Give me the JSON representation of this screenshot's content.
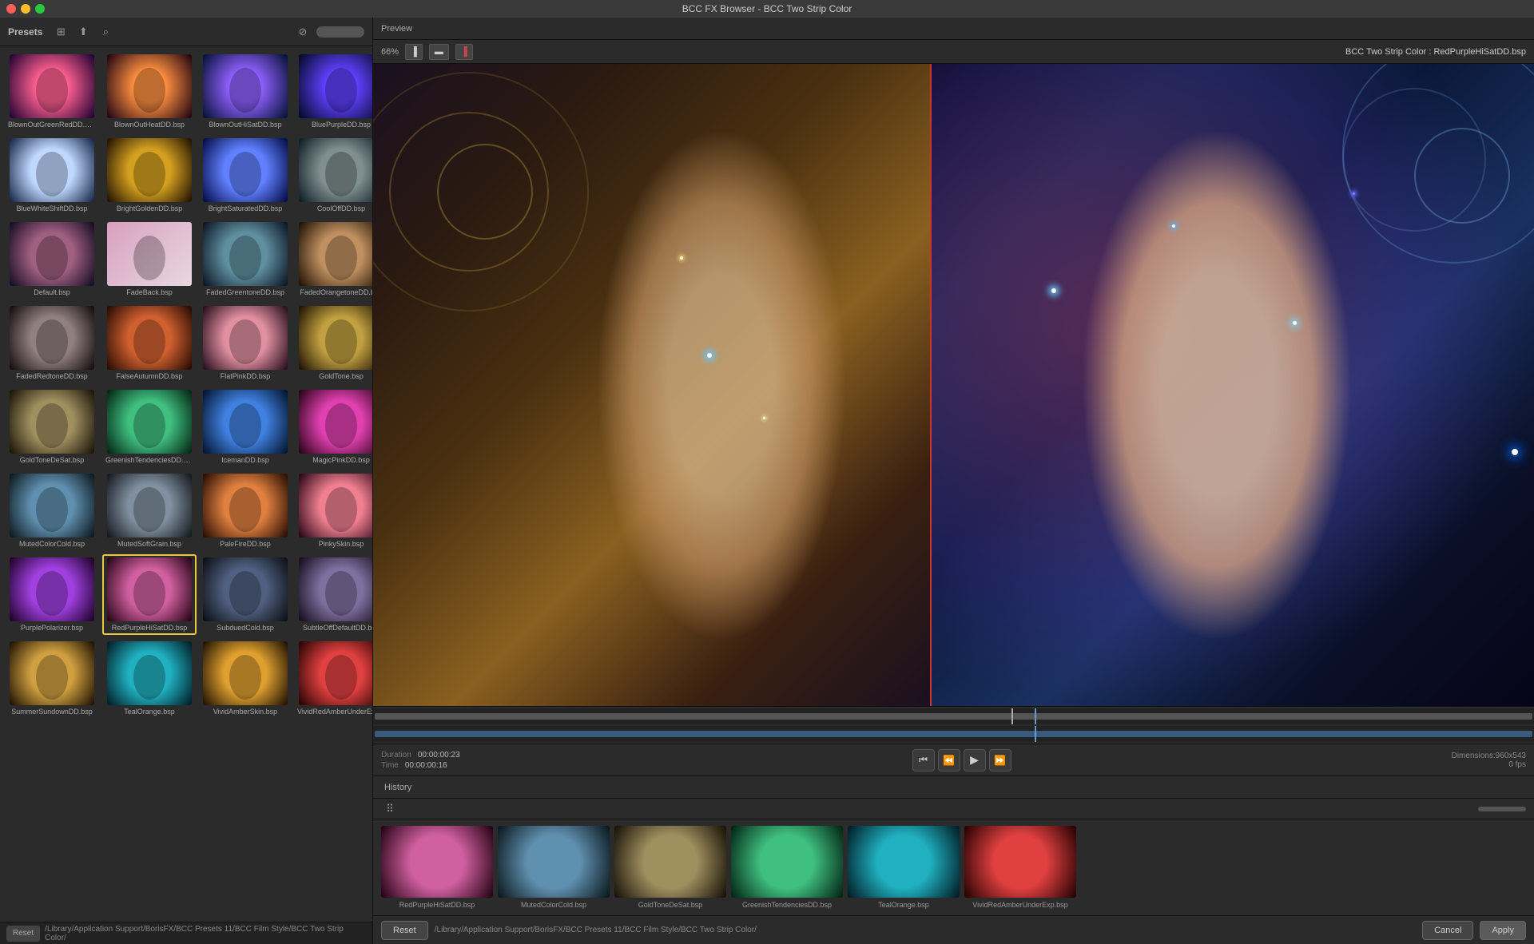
{
  "window": {
    "title": "BCC FX Browser - BCC Two Strip Color"
  },
  "leftPanel": {
    "title": "Presets",
    "searchPlaceholder": "Search"
  },
  "presets": [
    {
      "id": "blown-out-green",
      "label": "BlownOutGreenRedDD.bsp",
      "thumbClass": "thumb-blown-out-green",
      "selected": false
    },
    {
      "id": "blown-out-heat",
      "label": "BlownOutHeatDD.bsp",
      "thumbClass": "thumb-blown-out-heat",
      "selected": false
    },
    {
      "id": "blown-out-sat",
      "label": "BlownOutHiSatDD.bsp",
      "thumbClass": "thumb-blown-out-sat",
      "selected": false
    },
    {
      "id": "blue-purple",
      "label": "BluePurpleDD.bsp",
      "thumbClass": "thumb-blue-purple",
      "selected": false
    },
    {
      "id": "blue-white",
      "label": "BlueWhiteShiftDD.bsp",
      "thumbClass": "thumb-blue-white",
      "selected": false
    },
    {
      "id": "bright-golden",
      "label": "BrightGoldenDD.bsp",
      "thumbClass": "thumb-bright-golden",
      "selected": false
    },
    {
      "id": "bright-sat",
      "label": "BrightSaturatedDD.bsp",
      "thumbClass": "thumb-bright-sat",
      "selected": false
    },
    {
      "id": "cool-off",
      "label": "CoolOffDD.bsp",
      "thumbClass": "thumb-cool-off",
      "selected": false
    },
    {
      "id": "default",
      "label": "Default.bsp",
      "thumbClass": "thumb-default",
      "selected": false
    },
    {
      "id": "fadeback",
      "label": "FadeBack.bsp",
      "thumbClass": "thumb-fadeback",
      "selected": false
    },
    {
      "id": "faded-green",
      "label": "FadedGreentoneDD.bsp",
      "thumbClass": "thumb-faded-green",
      "selected": false
    },
    {
      "id": "faded-orange",
      "label": "FadedOrangetoneDD.bsp",
      "thumbClass": "thumb-faded-orange",
      "selected": false
    },
    {
      "id": "faded-red",
      "label": "FadedRedtoneDD.bsp",
      "thumbClass": "thumb-faded-red",
      "selected": false
    },
    {
      "id": "false-autumn",
      "label": "FalseAutumnDD.bsp",
      "thumbClass": "thumb-false-autumn",
      "selected": false
    },
    {
      "id": "flat-pink",
      "label": "FlatPinkDD.bsp",
      "thumbClass": "thumb-flat-pink",
      "selected": false
    },
    {
      "id": "goldtone",
      "label": "GoldTone.bsp",
      "thumbClass": "thumb-goldtone",
      "selected": false
    },
    {
      "id": "goldtone-desat",
      "label": "GoldToneDeSat.bsp",
      "thumbClass": "thumb-goldtone-desat",
      "selected": false
    },
    {
      "id": "greenish",
      "label": "GreenishTendenciesDD.bsp",
      "thumbClass": "thumb-greenish",
      "selected": false
    },
    {
      "id": "iceman",
      "label": "IcemanDD.bsp",
      "thumbClass": "thumb-iceman",
      "selected": false
    },
    {
      "id": "magic-pink",
      "label": "MagicPinkDD.bsp",
      "thumbClass": "thumb-magic-pink",
      "selected": false
    },
    {
      "id": "muted-cold",
      "label": "MutedColorCold.bsp",
      "thumbClass": "thumb-muted-cold",
      "selected": false
    },
    {
      "id": "muted-soft",
      "label": "MutedSoftGrain.bsp",
      "thumbClass": "thumb-muted-soft",
      "selected": false
    },
    {
      "id": "pale-fire",
      "label": "PaleFireDD.bsp",
      "thumbClass": "thumb-pale-fire",
      "selected": false
    },
    {
      "id": "pinky",
      "label": "PinkySkin.bsp",
      "thumbClass": "thumb-pinky",
      "selected": false
    },
    {
      "id": "purple-pol",
      "label": "PurplePolarizer.bsp",
      "thumbClass": "thumb-purple-pol",
      "selected": false
    },
    {
      "id": "red-purple",
      "label": "RedPurpleHiSatDD.bsp",
      "thumbClass": "thumb-red-purple",
      "selected": true
    },
    {
      "id": "subdued-cold",
      "label": "SubduedCold.bsp",
      "thumbClass": "thumb-subdued-cold",
      "selected": false
    },
    {
      "id": "subtle-off",
      "label": "SubtleOffDefaultDD.bsp",
      "thumbClass": "thumb-subtle-off",
      "selected": false
    },
    {
      "id": "summer-sun",
      "label": "SummerSundownDD.bsp",
      "thumbClass": "thumb-summer-sun",
      "selected": false
    },
    {
      "id": "teal-orange",
      "label": "TealOrange.bsp",
      "thumbClass": "thumb-teal-orange",
      "selected": false
    },
    {
      "id": "vivid-amber",
      "label": "VividAmberSkin.bsp",
      "thumbClass": "thumb-vivid-amber",
      "selected": false
    },
    {
      "id": "vivid-red",
      "label": "VividRedAmberUnderExp.bsp",
      "thumbClass": "thumb-vivid-red",
      "selected": false
    }
  ],
  "preview": {
    "title": "Preview",
    "zoom": "66%",
    "presetName": "BCC Two Strip Color : RedPurpleHiSatDD.bsp",
    "viewModes": [
      "split-left",
      "split-center",
      "split-right"
    ]
  },
  "playback": {
    "duration": "00:00:00:23",
    "time": "00:00:00:16",
    "durationLabel": "Duration",
    "timeLabel": "Time",
    "dimensions": "Dimensions:960x543",
    "fps": "0 fps"
  },
  "history": {
    "title": "History",
    "items": [
      {
        "label": "RedPurpleHiSatDD.bsp",
        "thumbClass": "thumb-red-purple"
      },
      {
        "label": "MutedColorCold.bsp",
        "thumbClass": "thumb-muted-cold"
      },
      {
        "label": "GoldToneDeSat.bsp",
        "thumbClass": "thumb-goldtone-desat"
      },
      {
        "label": "GreenishTendenciesDD.bsp",
        "thumbClass": "thumb-greenish"
      },
      {
        "label": "TealOrange.bsp",
        "thumbClass": "thumb-teal-orange"
      },
      {
        "label": "VividRedAmberUnderExp.bsp",
        "thumbClass": "thumb-vivid-red"
      }
    ]
  },
  "bottomBar": {
    "resetLabel": "Reset",
    "cancelLabel": "Cancel",
    "applyLabel": "Apply",
    "path": "/Library/Application Support/BorisFX/BCC Presets 11/BCC Film Style/BCC Two Strip Color/"
  }
}
